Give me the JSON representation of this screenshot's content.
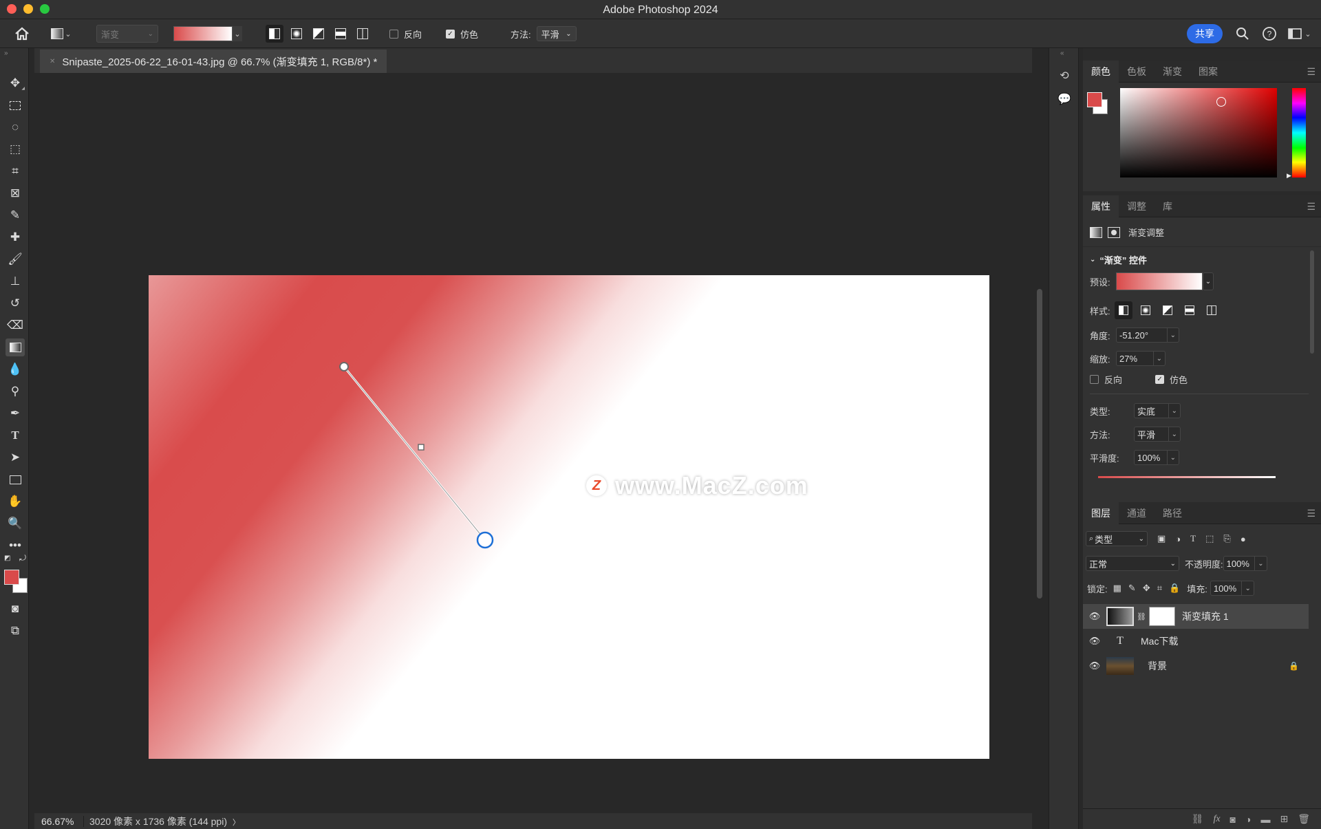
{
  "window": {
    "title": "Adobe Photoshop 2024"
  },
  "options_bar": {
    "tool_preset_placeholder": "渐变",
    "reverse_label": "反向",
    "reverse_checked": false,
    "dither_label": "仿色",
    "dither_checked": true,
    "method_label": "方法:",
    "method_value": "平滑",
    "share_label": "共享"
  },
  "document": {
    "tab_title": "Snipaste_2025-06-22_16-01-43.jpg @ 66.7% (渐变填充 1, RGB/8*) *",
    "watermark_logo": "Z",
    "watermark_text": "www.MacZ.com"
  },
  "status": {
    "zoom": "66.67%",
    "doc_info": "3020 像素 x 1736 像素 (144 ppi)",
    "arrow": "〉"
  },
  "color_panel": {
    "tabs": [
      "颜色",
      "色板",
      "渐变",
      "图案"
    ],
    "foreground_color": "#d94a4a",
    "background_color": "#ffffff"
  },
  "properties_panel": {
    "tabs": [
      "属性",
      "调整",
      "库"
    ],
    "header_label": "渐变调整",
    "section_title": "“渐变” 控件",
    "preset_label": "预设:",
    "style_label": "样式:",
    "angle_label": "角度:",
    "angle_value": "-51.20°",
    "scale_label": "缩放:",
    "scale_value": "27%",
    "reverse_label": "反向",
    "reverse_checked": false,
    "dither_label": "仿色",
    "dither_checked": true,
    "type_label": "类型:",
    "type_value": "实底",
    "method_label": "方法:",
    "method_value": "平滑",
    "smoothness_label": "平滑度:",
    "smoothness_value": "100%"
  },
  "layers_panel": {
    "tabs": [
      "图层",
      "通道",
      "路径"
    ],
    "filter_label": "类型",
    "blend_mode": "正常",
    "opacity_label": "不透明度:",
    "opacity_value": "100%",
    "lock_label": "锁定:",
    "fill_label": "填充:",
    "fill_value": "100%",
    "layers": [
      {
        "name": "渐变填充 1"
      },
      {
        "name": "Mac下载"
      },
      {
        "name": "背景"
      }
    ]
  }
}
